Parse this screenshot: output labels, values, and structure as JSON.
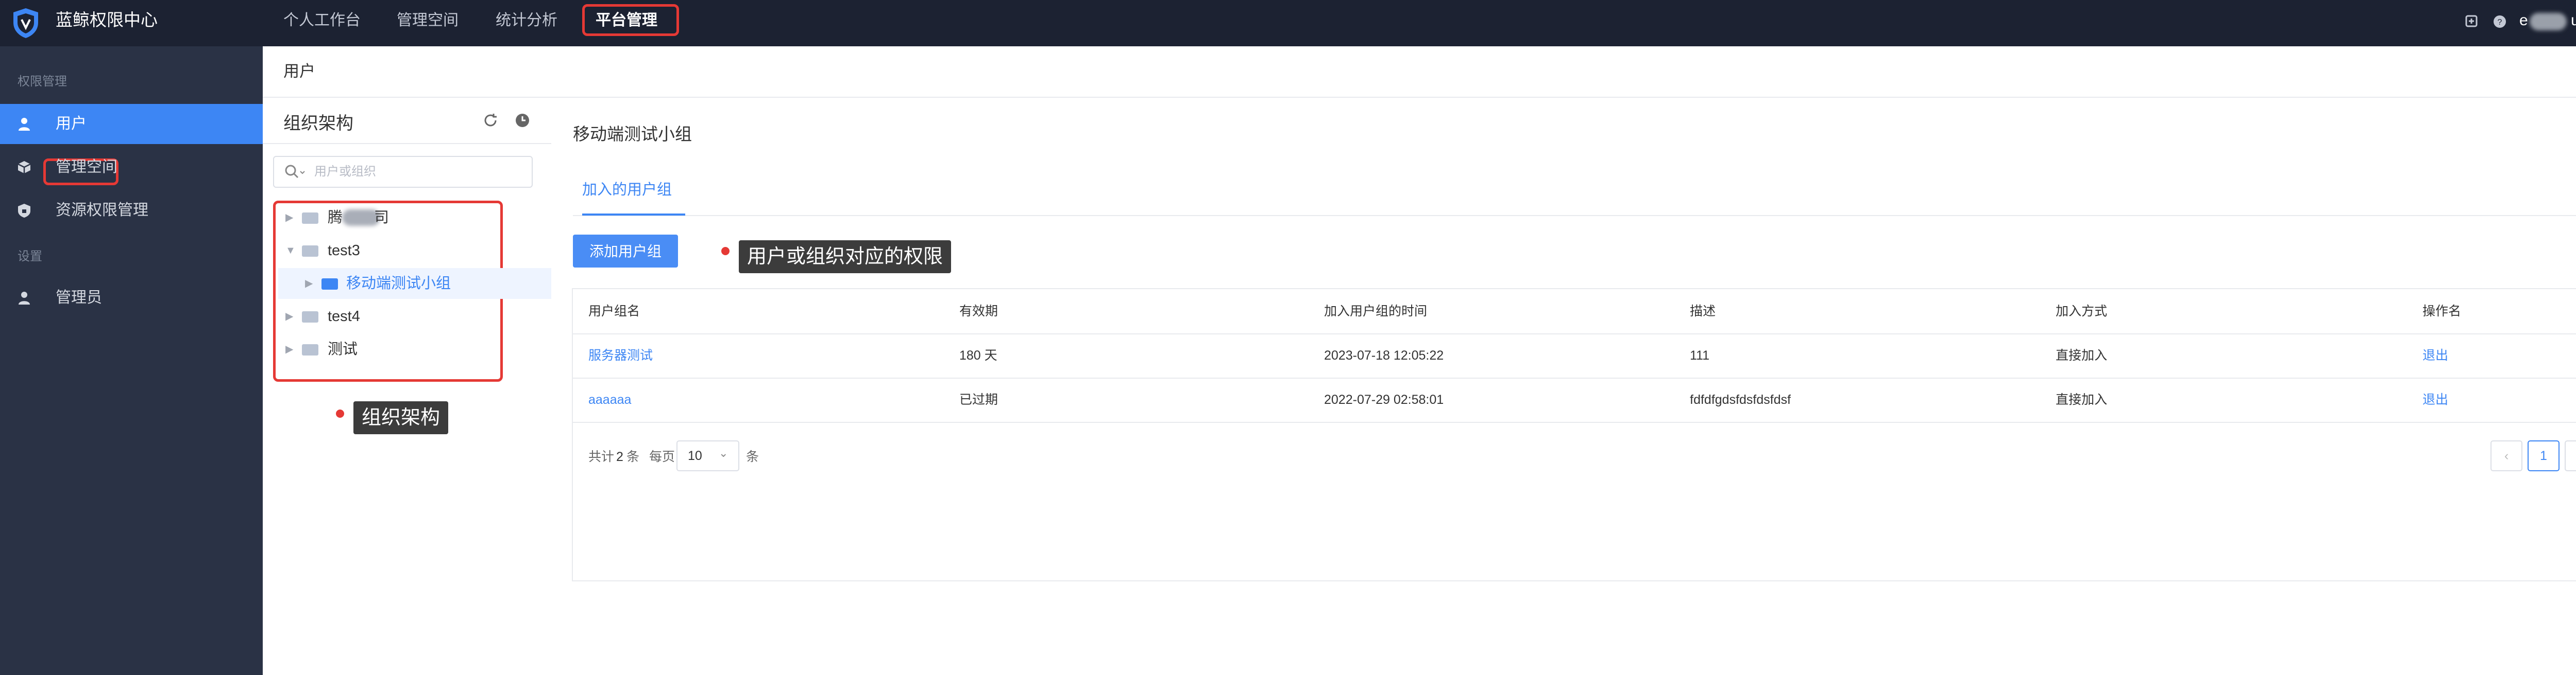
{
  "app": {
    "title": "蓝鲸权限中心"
  },
  "topnav": [
    {
      "label": "个人工作台"
    },
    {
      "label": "管理空间"
    },
    {
      "label": "统计分析"
    },
    {
      "label": "平台管理"
    }
  ],
  "user": {
    "name_start": "e",
    "name_end": "u"
  },
  "sidebar": {
    "section_permission": "权限管理",
    "items": [
      {
        "label": "用户"
      },
      {
        "label": "管理空间"
      },
      {
        "label": "资源权限管理"
      }
    ],
    "section_settings": "设置",
    "settings_items": [
      {
        "label": "管理员"
      }
    ]
  },
  "breadcrumb": {
    "current": "用户"
  },
  "org": {
    "title": "组织架构",
    "search_placeholder": "用户或组织",
    "tree": [
      {
        "label_start": "腾",
        "label_end": "司"
      },
      {
        "label": "test3"
      },
      {
        "label": "移动端测试小组"
      },
      {
        "label": "test4"
      },
      {
        "label": "测试"
      }
    ],
    "annotation": "组织架构"
  },
  "main": {
    "group_title": "移动端测试小组",
    "tab": "加入的用户组",
    "add_button": "添加用户组",
    "annotation": "用户或组织对应的权限",
    "columns": [
      "用户组名",
      "有效期",
      "加入用户组的时间",
      "描述",
      "加入方式",
      "操作名"
    ],
    "rows": [
      {
        "name": "服务器测试",
        "validity": "180 天",
        "joined": "2023-07-18 12:05:22",
        "desc": "111",
        "method": "直接加入",
        "action": "退出"
      },
      {
        "name": "aaaaaa",
        "validity": "已过期",
        "joined": "2022-07-29 02:58:01",
        "desc": "fdfdfgdsfdsfdsfdsf",
        "method": "直接加入",
        "action": "退出"
      }
    ],
    "pager": {
      "total_prefix": "共计",
      "total": "2",
      "total_suffix": "条",
      "per_page_label": "每页",
      "per_page": "10",
      "per_page_suffix": "条",
      "current_page": "1"
    }
  },
  "colors": {
    "topbar": "#1c2232",
    "sidebar": "#2a3245",
    "accent": "#3d86f4",
    "highlight": "#e53935"
  }
}
